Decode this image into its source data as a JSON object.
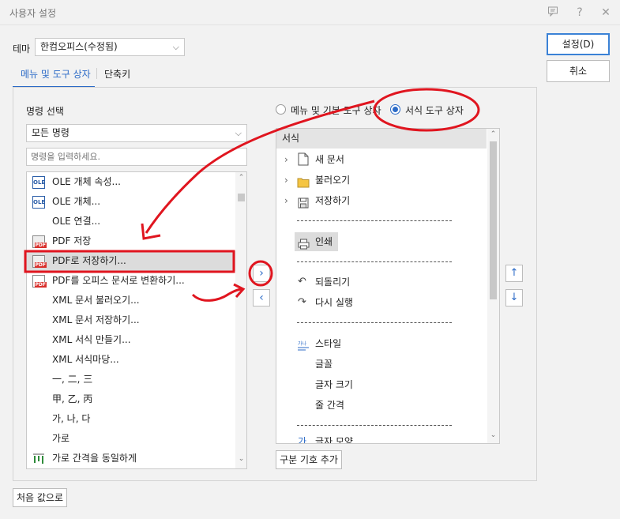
{
  "window": {
    "title": "사용자 설정",
    "icons": [
      "feedback-icon",
      "help-icon",
      "close-icon"
    ],
    "help_glyph": "?",
    "close_glyph": "✕"
  },
  "theme": {
    "label": "테마",
    "value": "한컴오피스(수정됨)"
  },
  "tabs": [
    {
      "label": "메뉴 및 도구 상자",
      "active": true
    },
    {
      "label": "단축키",
      "active": false
    }
  ],
  "buttons": {
    "ok": "설정(D)",
    "cancel": "취소",
    "reset": "처음 값으로",
    "add_separator": "구분 기호 추가"
  },
  "command_select": {
    "label": "명령 선택",
    "category_value": "모든 명령",
    "search_placeholder": "명령을 입력하세요.",
    "items": [
      {
        "label": "OLE 개체 속성...",
        "icon": "ole-icon"
      },
      {
        "label": "OLE 개체...",
        "icon": "ole-icon"
      },
      {
        "label": "OLE 연결...",
        "icon": ""
      },
      {
        "label": "PDF 저장",
        "icon": "pdf-save-icon"
      },
      {
        "label": "PDF로 저장하기...",
        "icon": "pdf-save-icon",
        "selected": true
      },
      {
        "label": "PDF를 오피스 문서로 변환하기...",
        "icon": "pdf-convert-icon"
      },
      {
        "label": "XML 문서 불러오기...",
        "icon": ""
      },
      {
        "label": "XML 문서 저장하기...",
        "icon": ""
      },
      {
        "label": "XML 서식 만들기...",
        "icon": ""
      },
      {
        "label": "XML 서식마당...",
        "icon": ""
      },
      {
        "label": "一, 二, 三",
        "icon": ""
      },
      {
        "label": "甲, 乙, 丙",
        "icon": ""
      },
      {
        "label": "가, 나, 다",
        "icon": ""
      },
      {
        "label": "가로",
        "icon": ""
      },
      {
        "label": "가로 간격을 동일하게",
        "icon": "align-spacing-icon"
      }
    ]
  },
  "toolbox_options": {
    "radio_menu": "메뉴 및 기본 도구 상자",
    "radio_format": "서식 도구 상자",
    "selected": "radio_format"
  },
  "toolbox_tree": {
    "header": "서식",
    "items": [
      {
        "label": "새 문서",
        "icon": "new-document-icon",
        "expandable": true
      },
      {
        "label": "불러오기",
        "icon": "open-folder-icon",
        "expandable": true
      },
      {
        "label": "저장하기",
        "icon": "save-icon",
        "expandable": true
      },
      {
        "label": "인쇄",
        "icon": "print-icon",
        "highlighted": true
      },
      {
        "label": "되돌리기",
        "icon": "undo-icon"
      },
      {
        "label": "다시 실행",
        "icon": "redo-icon"
      },
      {
        "label": "스타일",
        "icon": "style-icon"
      },
      {
        "label": "글꼴",
        "icon": ""
      },
      {
        "label": "글자 크기",
        "icon": ""
      },
      {
        "label": "줄 간격",
        "icon": ""
      },
      {
        "label": "글자 모양",
        "icon": "char-shape-icon",
        "partial": true
      }
    ],
    "separator": "---------------------------------"
  },
  "move_buttons": {
    "add": "›",
    "remove": "‹",
    "up": "↑",
    "down": "↓"
  },
  "colors": {
    "accent": "#2c6bc7",
    "annotation": "#e0151f"
  }
}
